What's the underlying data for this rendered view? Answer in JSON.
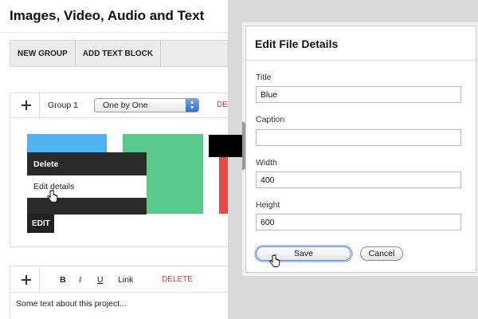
{
  "editor": {
    "title": "Images, Video, Audio and Text",
    "toolbar": {
      "new_group": "NEW GROUP",
      "add_text_block": "ADD TEXT BLOCK"
    },
    "group": {
      "label": "Group 1",
      "mode_value": "One by One",
      "delete_label": "DELE"
    },
    "media_blocks": {
      "colors": [
        "#4fb3f2",
        "#58c98b",
        "#e54a44"
      ]
    },
    "context_menu": {
      "delete": "Delete",
      "edit_details": "Edit details"
    },
    "edit_tag": "EDIT",
    "text_block": {
      "bold": "B",
      "italic": "I",
      "underline": "U",
      "link": "Link",
      "delete": "DELETE",
      "content": "Some text about this project..."
    }
  },
  "dialog": {
    "title": "Edit File Details",
    "fields": [
      {
        "label": "Title",
        "value": "Blue"
      },
      {
        "label": "Caption",
        "value": ""
      },
      {
        "label": "Width",
        "value": "400"
      },
      {
        "label": "Height",
        "value": "600"
      }
    ],
    "save_label": "Save",
    "cancel_label": "Cancel"
  },
  "colors": {
    "delete_red": "#d63a32",
    "accent_blue": "#2f6fd1"
  },
  "icons": [
    "move-icon",
    "hand-cursor-icon",
    "right-arrow-icon",
    "select-arrows-icon"
  ]
}
